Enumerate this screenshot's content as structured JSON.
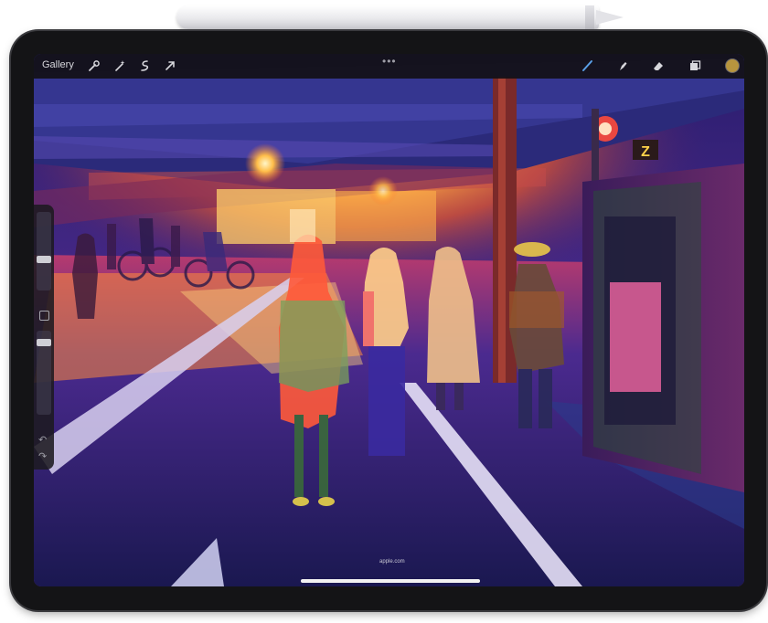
{
  "app": {
    "gallery_label": "Gallery",
    "toolbar_left": [
      "wrench-icon",
      "magic-wand-icon",
      "selection-icon",
      "transform-arrow-icon"
    ],
    "more_menu": "•••",
    "toolbar_right": [
      "brush-icon",
      "smudge-icon",
      "eraser-icon",
      "layers-icon",
      "color-swatch-icon"
    ],
    "current_color": "#b7953e"
  },
  "sidebar": {
    "controls": [
      "brush-size-slider",
      "modify-button",
      "opacity-slider",
      "undo-icon",
      "redo-icon"
    ],
    "undo_glyph": "↶",
    "redo_glyph": "↷"
  },
  "canvas": {
    "watermark": "apple.com"
  },
  "colors": {
    "bezel": "#141416",
    "toolbar_bg": "#121016",
    "accent_sign": "#ffd24a"
  }
}
